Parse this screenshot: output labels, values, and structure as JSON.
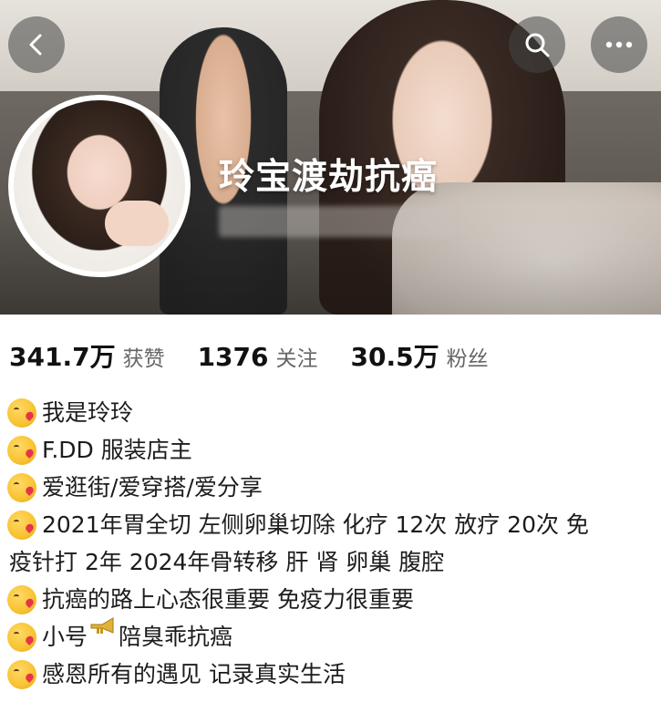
{
  "header": {
    "display_name": "玲宝渡劫抗癌",
    "back_icon": "chevron-left-icon",
    "search_icon": "search-icon",
    "more_icon": "more-dots-icon"
  },
  "stats": [
    {
      "value": "341.7万",
      "label": "获赞"
    },
    {
      "value": "1376",
      "label": "关注"
    },
    {
      "value": "30.5万",
      "label": "粉丝"
    }
  ],
  "bio": {
    "line1": "我是玲玲",
    "line2": "F.DD 服装店主",
    "line3": "爱逛街/爱穿搭/爱分享",
    "line4": "2021年胃全切 左侧卵巢切除 化疗 12次 放疗 20次 免",
    "line4_cont": "疫针打 2年 2024年骨转移 肝 肾 卵巢 腹腔",
    "line5": "抗癌的路上心态很重要 免疫力很重要",
    "line6_pre": "小号",
    "line6_post": "陪臭乖抗癌",
    "line7": "感恩所有的遇见 记录真实生活"
  },
  "colors": {
    "stat_number": "#111111",
    "stat_label": "#666666",
    "nav_button_bg": "#464646"
  }
}
